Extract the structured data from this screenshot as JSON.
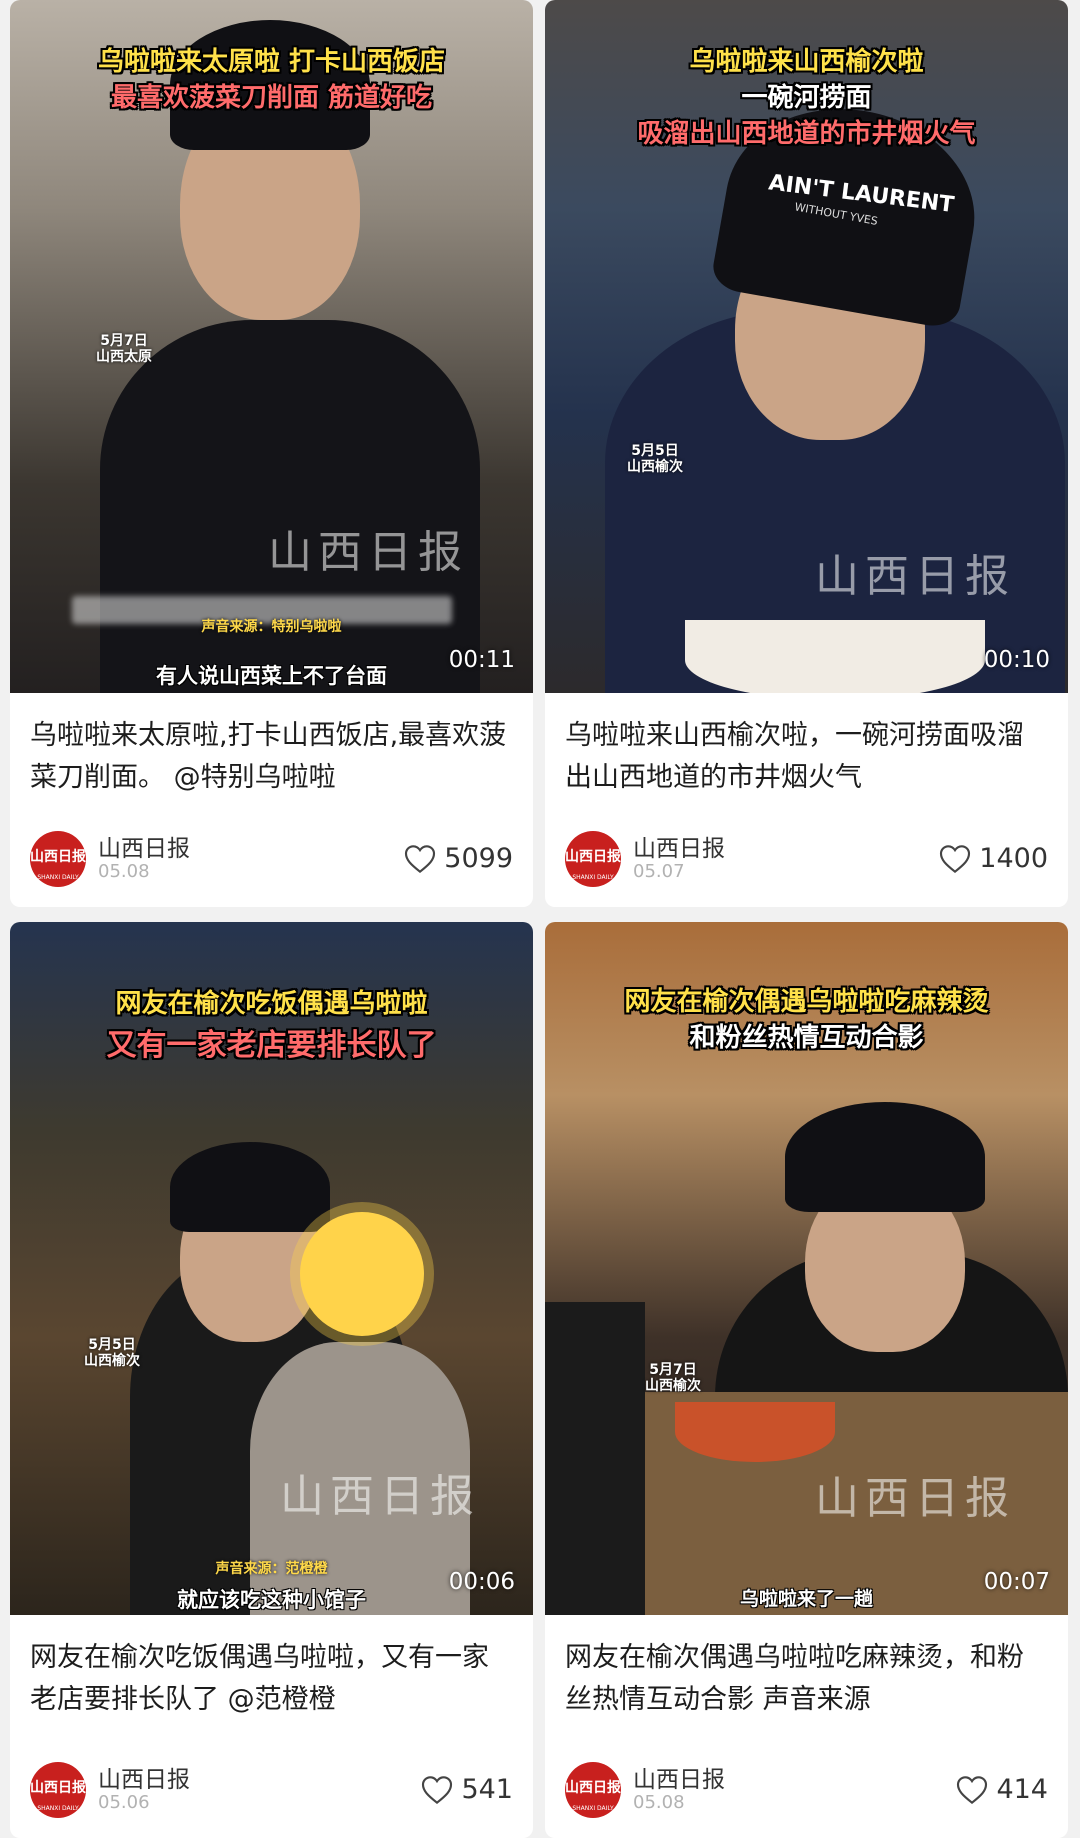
{
  "cards": [
    {
      "overlay_line1": "乌啦啦来太原啦 打卡山西饭店",
      "overlay_line2": "最喜欢菠菜刀削面 筋道好吃",
      "date_tag": "5月7日",
      "place_tag": "山西太原",
      "source_label": "声音来源：特别乌啦啦",
      "bottom_subtitle": "有人说山西菜上不了台面",
      "watermark": "山西日报",
      "duration": "00:11",
      "caption": "乌啦啦来太原啦,打卡山西饭店,最喜欢菠菜刀削面。 @特别乌啦啦",
      "author": "山西日报",
      "date": "05.08",
      "likes": "5099"
    },
    {
      "overlay_line1": "乌啦啦来山西榆次啦",
      "overlay_line2": "一碗河捞面",
      "overlay_line3": "吸溜出山西地道的市井烟火气",
      "date_tag": "5月5日",
      "place_tag": "山西榆次",
      "cap_text": "AIN'T LAURENT",
      "cap_sub": "WITHOUT YVES",
      "watermark": "山西日报",
      "duration": "00:10",
      "caption": "乌啦啦来山西榆次啦，一碗河捞面吸溜出山西地道的市井烟火气",
      "author": "山西日报",
      "date": "05.07",
      "likes": "1400"
    },
    {
      "overlay_line1": "网友在榆次吃饭偶遇乌啦啦",
      "overlay_line2": "又有一家老店要排长队了",
      "date_tag": "5月5日",
      "place_tag": "山西榆次",
      "source_label": "声音来源：范橙橙",
      "bottom_subtitle": "就应该吃这种小馆子",
      "watermark": "山西日报",
      "duration": "00:06",
      "caption": "网友在榆次吃饭偶遇乌啦啦，又有一家老店要排长队了 @范橙橙",
      "author": "山西日报",
      "date": "05.06",
      "likes": "541"
    },
    {
      "overlay_line1": "网友在榆次偶遇乌啦啦吃麻辣烫",
      "overlay_line2": "和粉丝热情互动合影",
      "date_tag": "5月7日",
      "place_tag": "山西榆次",
      "bottom_subtitle": "乌啦啦来了一趟",
      "watermark": "山西日报",
      "duration": "00:07",
      "caption": "网友在榆次偶遇乌啦啦吃麻辣烫，和粉丝热情互动合影 声音来源",
      "author": "山西日报",
      "date": "05.08",
      "likes": "414"
    }
  ],
  "avatar": {
    "logo_text": "山西日报",
    "logo_sub": "SHANXI DAILY"
  },
  "colors": {
    "brand_red": "#c8201e",
    "overlay_yellow": "#ffe14a",
    "overlay_pink": "#ff6b6b"
  },
  "icons": {
    "like": "heart-outline-icon"
  }
}
